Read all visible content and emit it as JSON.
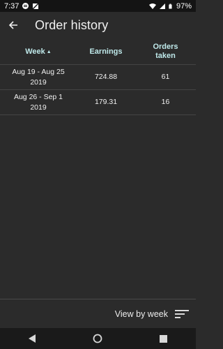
{
  "status_bar": {
    "time": "7:37",
    "battery": "97%"
  },
  "header": {
    "title": "Order history",
    "back_icon": "arrow-left-icon"
  },
  "table": {
    "columns": [
      "Week",
      "Earnings",
      "Orders\ntaken"
    ],
    "sort_indicator": "▲",
    "rows": [
      {
        "week_line1": "Aug 19 - Aug 25",
        "week_line2": "2019",
        "earnings": "724.88",
        "orders": "61"
      },
      {
        "week_line1": "Aug 26 - Sep 1",
        "week_line2": "2019",
        "earnings": "179.31",
        "orders": "16"
      }
    ]
  },
  "bottom": {
    "view_label": "View by week",
    "filter_icon": "sort-lines-icon"
  },
  "colors": {
    "background": "#2b2b2b",
    "header_text": "#bfe9ea"
  }
}
